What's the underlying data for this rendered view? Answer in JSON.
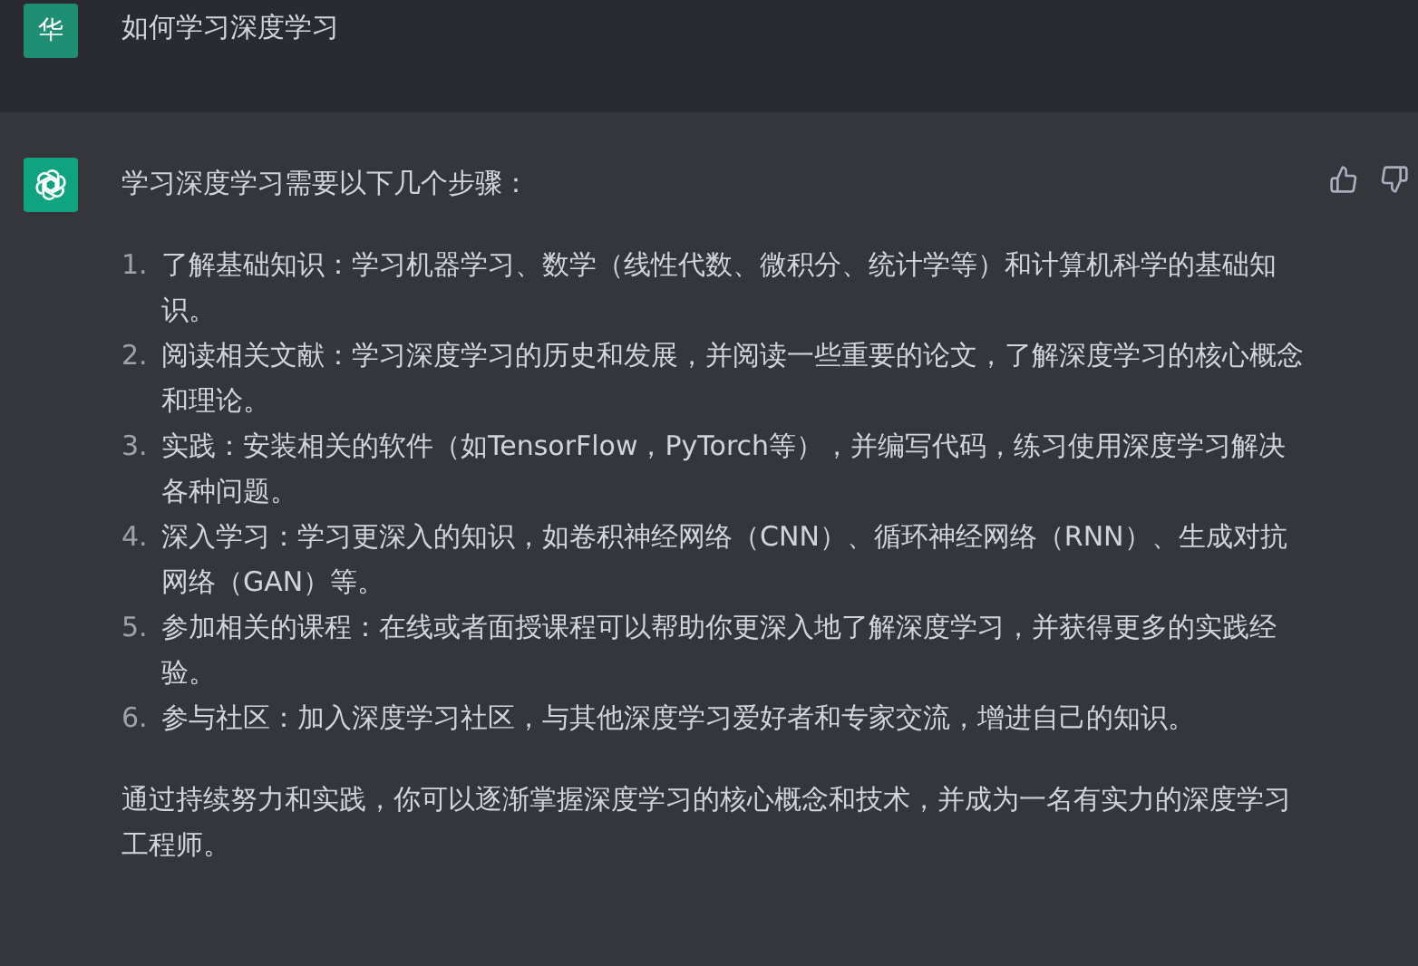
{
  "user_message": {
    "avatar": "华",
    "text": "如何学习深度学习"
  },
  "assistant_message": {
    "intro": "学习深度学习需要以下几个步骤：",
    "steps": [
      {
        "number": "1.",
        "text": "了解基础知识：学习机器学习、数学（线性代数、微积分、统计学等）和计算机科学的基础知识。"
      },
      {
        "number": "2.",
        "text": "阅读相关文献：学习深度学习的历史和发展，并阅读一些重要的论文，了解深度学习的核心概念和理论。"
      },
      {
        "number": "3.",
        "text": "实践：安装相关的软件（如TensorFlow，PyTorch等），并编写代码，练习使用深度学习解决各种问题。"
      },
      {
        "number": "4.",
        "text": "深入学习：学习更深入的知识，如卷积神经网络（CNN）、循环神经网络（RNN）、生成对抗网络（GAN）等。"
      },
      {
        "number": "5.",
        "text": "参加相关的课程：在线或者面授课程可以帮助你更深入地了解深度学习，并获得更多的实践经验。"
      },
      {
        "number": "6.",
        "text": "参与社区：加入深度学习社区，与其他深度学习爱好者和专家交流，增进自己的知识。"
      }
    ],
    "conclusion": "通过持续努力和实践，你可以逐渐掌握深度学习的核心概念和技术，并成为一名有实力的深度学习工程师。"
  }
}
